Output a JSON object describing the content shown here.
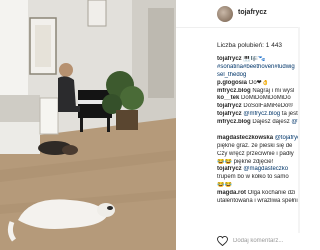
{
  "post": {
    "username": "tojafrycz",
    "likes_text": "Liczba polubień: 1 443",
    "comments": [
      {
        "user": "tojafrycz",
        "text": " 🎹🎼🐾",
        "tag": ""
      },
      {
        "user": "",
        "text": "",
        "tag": "#sonatina#beethoven#ludwig"
      },
      {
        "user": "",
        "text": "",
        "tag": "sel_thedog"
      },
      {
        "user": "p.glogosia",
        "text": " Oo❤👌",
        "tag": ""
      },
      {
        "user": "mfrycz.blog",
        "text": " Nagraj i mi wyśl",
        "tag": ""
      },
      {
        "user": "ko__tek",
        "text": " DoMiDoMiDoMiDo",
        "tag": ""
      },
      {
        "user": "tojafrycz",
        "text": " DoSolFaMiReDo®",
        "tag": ""
      },
      {
        "user": "tojafrycz",
        "text": " ",
        "tag": "@mfrycz.blog",
        "tail": " ta jest"
      },
      {
        "user": "mfrycz.blog",
        "text": " Dajesz dajesz ",
        "tag": "@tojafrycz"
      },
      {
        "user": "",
        "text": "",
        "tag": ""
      },
      {
        "user": "magdasteczkowska",
        "text": " ",
        "tag": "@tojafrycz"
      },
      {
        "user": "",
        "text": "piękne graż. ze pieski się de",
        "tag": ""
      },
      {
        "user": "",
        "text": "Czy wręcz przeciwnie i padły",
        "tag": ""
      },
      {
        "user": "",
        "text": "😂😂 piękne zdjęcie!",
        "tag": ""
      },
      {
        "user": "tojafrycz",
        "text": " ",
        "tag": "@magdasteczko"
      },
      {
        "user": "",
        "text": "trupem bo w kółko to samo",
        "tag": ""
      },
      {
        "user": "",
        "text": "😂😂",
        "tag": ""
      },
      {
        "user": "magda.rot",
        "text": " Olga kochanie dzi",
        "tag": ""
      },
      {
        "user": "",
        "text": "utalentowana i wrażliwa spełniasz jeo",
        "tag": ""
      }
    ],
    "comment_placeholder": "Dodaj komentarz..."
  },
  "colors": {
    "username": "#262626",
    "hashtag": "#003569",
    "placeholder": "#999999"
  },
  "icons": {
    "like": "heart-icon",
    "profile": "avatar"
  }
}
